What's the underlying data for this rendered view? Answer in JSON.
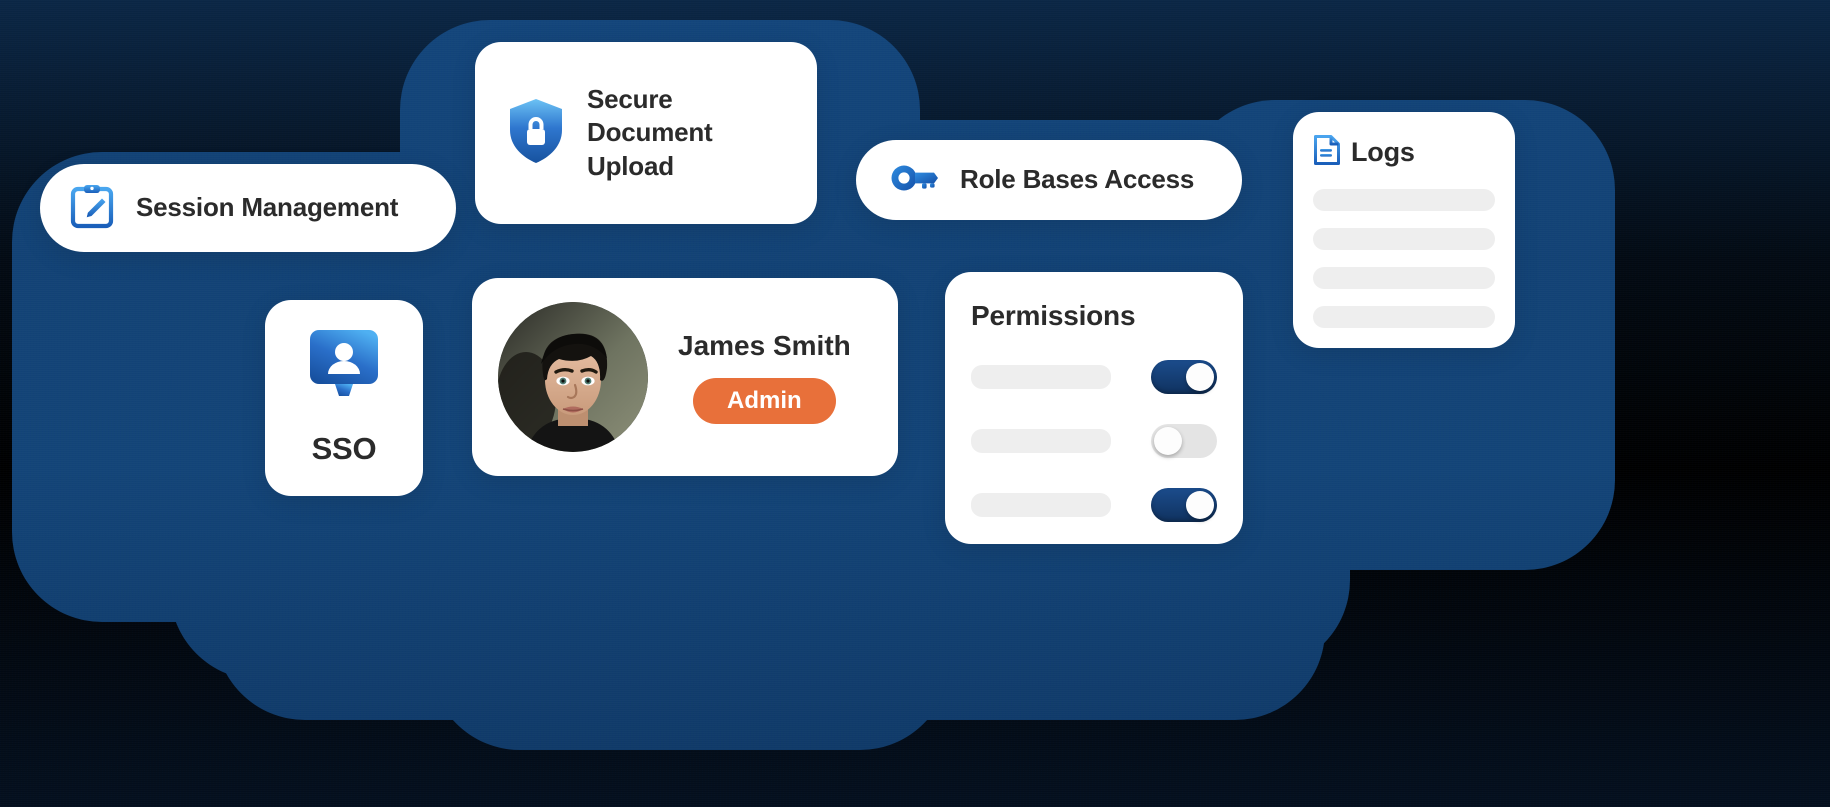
{
  "theme": {
    "page_background": "#000000",
    "blob_color": "#134477",
    "card_background": "#ffffff",
    "text_color": "#2b2b2b",
    "accent_blue": "#1f6fd0",
    "accent_navy": "#123a6e",
    "badge_orange": "#e8703a",
    "skeleton_gray": "#eeeeee"
  },
  "cards": {
    "session_management": {
      "label": "Session Management",
      "icon": "clipboard-pencil-icon"
    },
    "secure_document_upload": {
      "label": "Secure Document Upload",
      "icon": "shield-lock-icon"
    },
    "role_based_access": {
      "label": "Role Bases Access",
      "icon": "key-icon"
    },
    "logs": {
      "title": "Logs",
      "icon": "document-lines-icon",
      "placeholder_rows": 4
    },
    "sso": {
      "label": "SSO",
      "icon": "user-screen-icon"
    },
    "profile": {
      "name": "James Smith",
      "role_badge": "Admin",
      "avatar": "user-photo-avatar"
    },
    "permissions": {
      "title": "Permissions",
      "rows": [
        {
          "toggle_state": "on"
        },
        {
          "toggle_state": "off"
        },
        {
          "toggle_state": "on"
        }
      ]
    }
  }
}
